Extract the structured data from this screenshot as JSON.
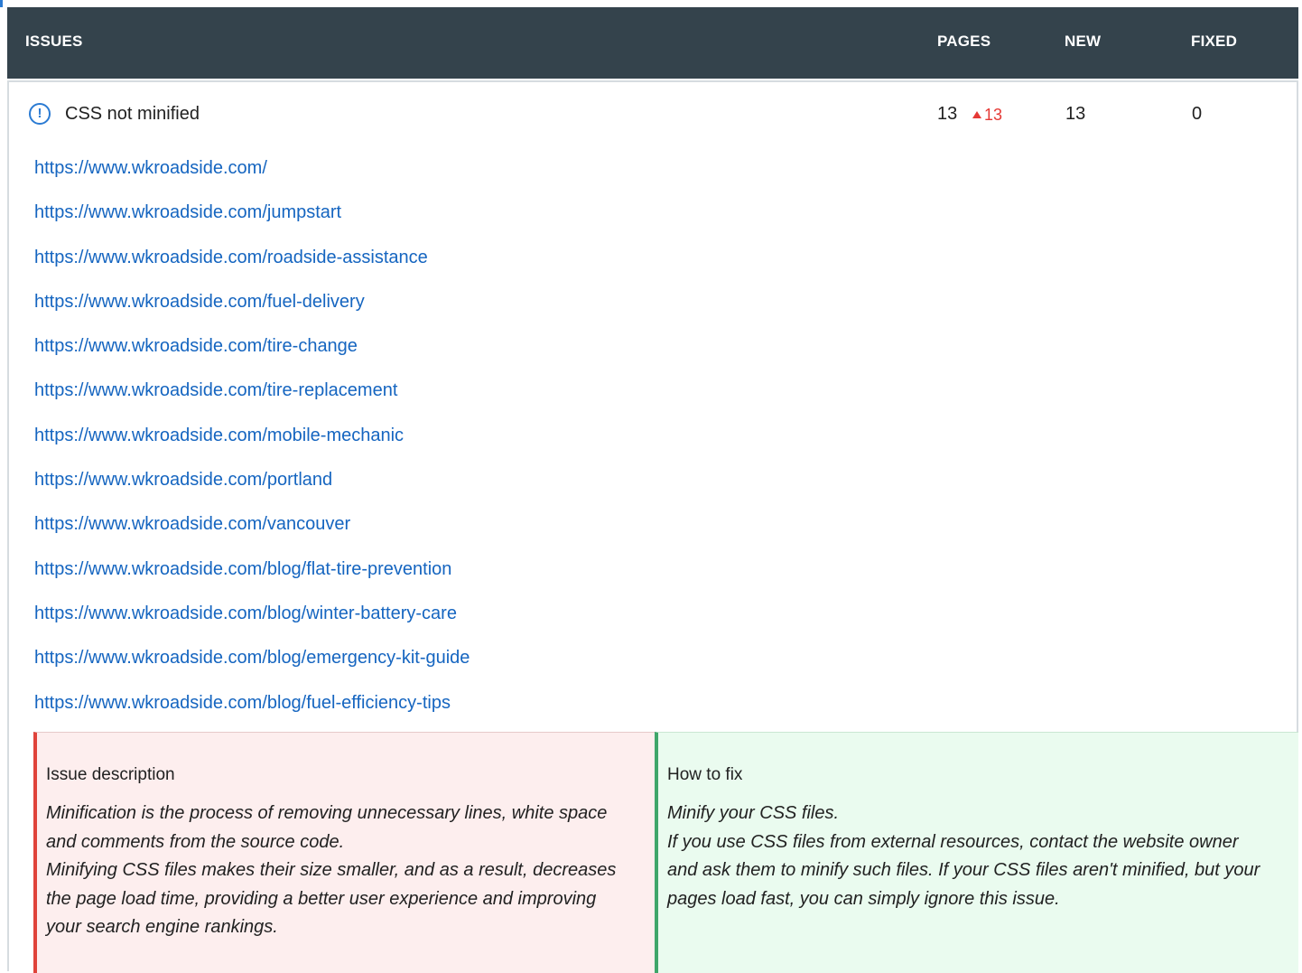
{
  "columns": {
    "issues": "ISSUES",
    "pages": "PAGES",
    "new": "NEW",
    "fixed": "FIXED"
  },
  "issue": {
    "icon": "alert-circle-icon",
    "title": "CSS not minified",
    "pages": "13",
    "pages_delta": "13",
    "new": "13",
    "fixed": "0",
    "colors": {
      "accent": "#2b7bd3",
      "delta": "#e53935"
    }
  },
  "urls": [
    "https://www.wkroadside.com/",
    "https://www.wkroadside.com/jumpstart",
    "https://www.wkroadside.com/roadside-assistance",
    "https://www.wkroadside.com/fuel-delivery",
    "https://www.wkroadside.com/tire-change",
    "https://www.wkroadside.com/tire-replacement",
    "https://www.wkroadside.com/mobile-mechanic",
    "https://www.wkroadside.com/portland",
    "https://www.wkroadside.com/vancouver",
    "https://www.wkroadside.com/blog/flat-tire-prevention",
    "https://www.wkroadside.com/blog/winter-battery-care",
    "https://www.wkroadside.com/blog/emergency-kit-guide",
    "https://www.wkroadside.com/blog/fuel-efficiency-tips"
  ],
  "description": {
    "title": "Issue description",
    "text": "Minification is the process of removing unnecessary lines, white space and comments from the source code.\nMinifying CSS files makes their size smaller, and as a result, decreases the page load time, providing a better user experience and improving your search engine rankings."
  },
  "fix": {
    "title": "How to fix",
    "text": "Minify your CSS files.\nIf you use CSS files from external resources, contact the website owner and ask them to minify such files. If your CSS files aren't minified, but your pages load fast, you can simply ignore this issue."
  },
  "theme": {
    "header_bg": "#34434c",
    "link": "#1565c0",
    "desc_bg": "#fdeeee",
    "desc_border": "#e0433a",
    "fix_bg": "#eafbef",
    "fix_border": "#3fa66a"
  }
}
